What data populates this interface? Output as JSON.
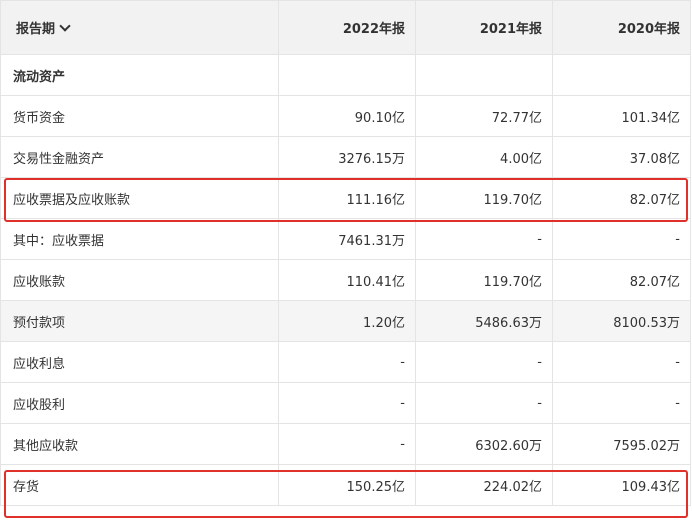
{
  "header": {
    "period_label": "报告期",
    "columns": [
      "2022年报",
      "2021年报",
      "2020年报"
    ]
  },
  "rows": [
    {
      "label": "流动资产",
      "values": [
        "",
        "",
        ""
      ]
    },
    {
      "label": "货币资金",
      "values": [
        "90.10亿",
        "72.77亿",
        "101.34亿"
      ]
    },
    {
      "label": "交易性金融资产",
      "values": [
        "3276.15万",
        "4.00亿",
        "37.08亿"
      ]
    },
    {
      "label": "应收票据及应收账款",
      "values": [
        "111.16亿",
        "119.70亿",
        "82.07亿"
      ]
    },
    {
      "label": "其中：应收票据",
      "values": [
        "7461.31万",
        "-",
        "-"
      ]
    },
    {
      "label": "应收账款",
      "values": [
        "110.41亿",
        "119.70亿",
        "82.07亿"
      ]
    },
    {
      "label": "预付款项",
      "values": [
        "1.20亿",
        "5486.63万",
        "8100.53万"
      ]
    },
    {
      "label": "应收利息",
      "values": [
        "-",
        "-",
        "-"
      ]
    },
    {
      "label": "应收股利",
      "values": [
        "-",
        "-",
        "-"
      ]
    },
    {
      "label": "其他应收款",
      "values": [
        "-",
        "6302.60万",
        "7595.02万"
      ]
    },
    {
      "label": "存货",
      "values": [
        "150.25亿",
        "224.02亿",
        "109.43亿"
      ]
    }
  ],
  "colors": {
    "highlight_border": "#e0302a",
    "header_bg": "#f2f2f2",
    "row_shade": "#f5f5f5",
    "grid_line": "#e4e4e4"
  }
}
